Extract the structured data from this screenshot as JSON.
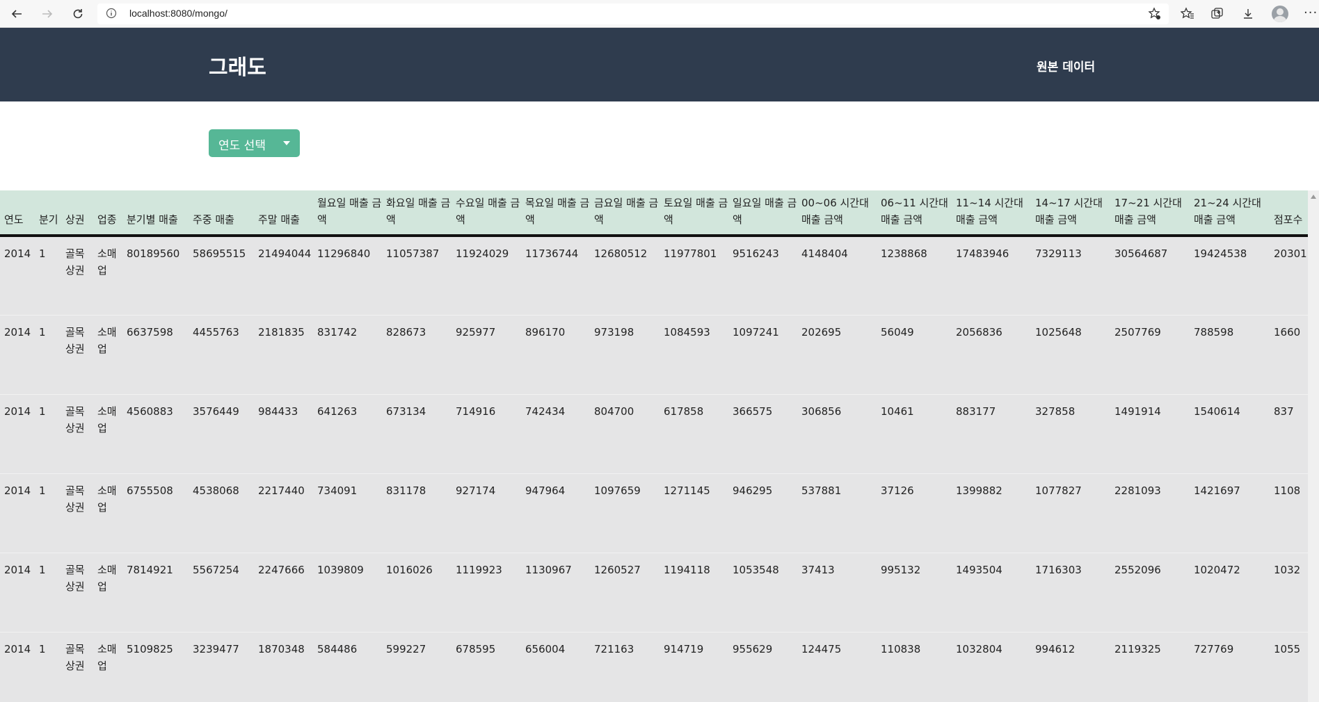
{
  "browser": {
    "url": "localhost:8080/mongo/"
  },
  "header": {
    "brand": "그래도",
    "nav_link": "원본 데이터"
  },
  "year_dropdown": {
    "label": "연도 선택"
  },
  "table": {
    "columns": [
      "연도",
      "분기",
      "상권",
      "업종",
      "분기별 매출",
      "주중 매출",
      "주말 매출",
      "월요일 매출 금액",
      "화요일 매출 금액",
      "수요일 매출 금액",
      "목요일 매출 금액",
      "금요일 매출 금액",
      "토요일 매출 금액",
      "일요일 매출 금액",
      "00~06 시간대 매출 금액",
      "06~11 시간대 매출 금액",
      "11~14 시간대 매출 금액",
      "14~17 시간대 매출 금액",
      "17~21 시간대 매출 금액",
      "21~24 시간대 매출 금액",
      "점포수"
    ],
    "rows": [
      [
        "2014",
        "1",
        "골목상권",
        "소매업",
        "80189560",
        "58695515",
        "21494044",
        "11296840",
        "11057387",
        "11924029",
        "11736744",
        "12680512",
        "11977801",
        "9516243",
        "4148404",
        "1238868",
        "17483946",
        "7329113",
        "30564687",
        "19424538",
        "20301"
      ],
      [
        "2014",
        "1",
        "골목상권",
        "소매업",
        "6637598",
        "4455763",
        "2181835",
        "831742",
        "828673",
        "925977",
        "896170",
        "973198",
        "1084593",
        "1097241",
        "202695",
        "56049",
        "2056836",
        "1025648",
        "2507769",
        "788598",
        "1660"
      ],
      [
        "2014",
        "1",
        "골목상권",
        "소매업",
        "4560883",
        "3576449",
        "984433",
        "641263",
        "673134",
        "714916",
        "742434",
        "804700",
        "617858",
        "366575",
        "306856",
        "10461",
        "883177",
        "327858",
        "1491914",
        "1540614",
        "837"
      ],
      [
        "2014",
        "1",
        "골목상권",
        "소매업",
        "6755508",
        "4538068",
        "2217440",
        "734091",
        "831178",
        "927174",
        "947964",
        "1097659",
        "1271145",
        "946295",
        "537881",
        "37126",
        "1399882",
        "1077827",
        "2281093",
        "1421697",
        "1108"
      ],
      [
        "2014",
        "1",
        "골목상권",
        "소매업",
        "7814921",
        "5567254",
        "2247666",
        "1039809",
        "1016026",
        "1119923",
        "1130967",
        "1260527",
        "1194118",
        "1053548",
        "37413",
        "995132",
        "1493504",
        "1716303",
        "2552096",
        "1020472",
        "1032"
      ],
      [
        "2014",
        "1",
        "골목상권",
        "소매업",
        "5109825",
        "3239477",
        "1870348",
        "584486",
        "599227",
        "678595",
        "656004",
        "721163",
        "914719",
        "955629",
        "124475",
        "110838",
        "1032804",
        "994612",
        "2119325",
        "727769",
        "1055"
      ]
    ]
  }
}
